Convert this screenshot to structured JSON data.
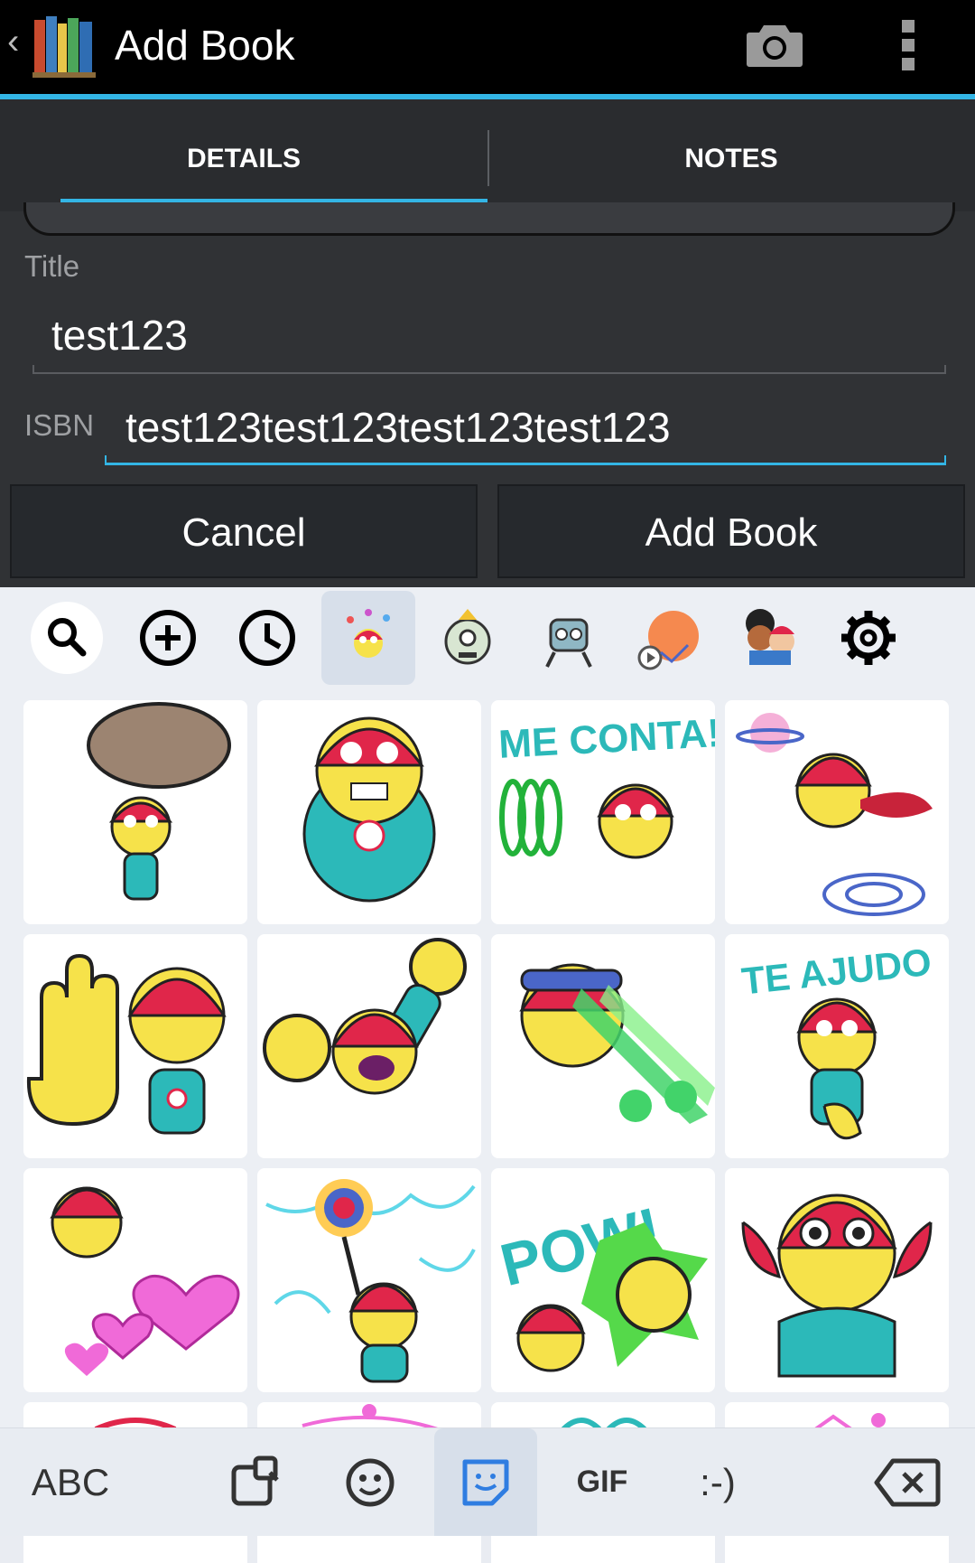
{
  "action_bar": {
    "title": "Add Book",
    "icons": [
      "back-chevron-icon",
      "books-app-icon",
      "camera-icon",
      "overflow-menu-icon"
    ]
  },
  "tabs": [
    {
      "label": "DETAILS",
      "selected": true
    },
    {
      "label": "NOTES",
      "selected": false
    }
  ],
  "form": {
    "title_label": "Title",
    "title_value": "test123",
    "isbn_label": "ISBN",
    "isbn_value": "test123test123test123test123"
  },
  "buttons": {
    "cancel": "Cancel",
    "add_book": "Add Book"
  },
  "keyboard": {
    "sticker_categories": [
      "search-icon",
      "add-circle-icon",
      "recent-clock-icon",
      "sticker-pack-candy-hero",
      "sticker-pack-zombie",
      "sticker-pack-robot",
      "sticker-pack-video",
      "sticker-pack-friends",
      "settings-gear-icon"
    ],
    "selected_category": "sticker-pack-candy-hero",
    "sticker_texts": [
      "ME CONTA!",
      "TE AJUDO",
      "POW!"
    ],
    "bottom_bar": {
      "abc": "ABC",
      "gif": "GIF",
      "emoticon": ":-)"
    },
    "active_bottom_key": "sticker-key"
  },
  "colors": {
    "accent": "#33b5e5",
    "action_bar_bg": "#000000",
    "tab_bg": "#2a2c2f",
    "form_bg": "#303235",
    "keyboard_bg": "#eceff4",
    "sticker_accent": "#4a66c8"
  }
}
